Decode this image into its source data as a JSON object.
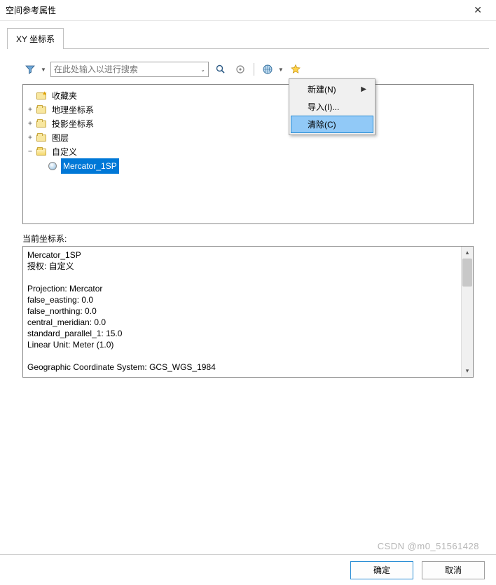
{
  "window": {
    "title": "空间参考属性",
    "close": "✕"
  },
  "tabs": {
    "active": "XY 坐标系"
  },
  "toolbar": {
    "search_placeholder": "在此处输入以进行搜索"
  },
  "dropdown": {
    "items": [
      {
        "label": "新建(N)",
        "has_submenu": true,
        "highlight": false
      },
      {
        "label": "导入(I)...",
        "has_submenu": false,
        "highlight": false
      },
      {
        "label": "清除(C)",
        "has_submenu": false,
        "highlight": true
      }
    ]
  },
  "tree": {
    "nodes": [
      {
        "label": "收藏夹",
        "icon": "fav",
        "toggle": "",
        "indent": 1
      },
      {
        "label": "地理坐标系",
        "icon": "folder-closed",
        "toggle": "+",
        "indent": 1
      },
      {
        "label": "投影坐标系",
        "icon": "folder-closed",
        "toggle": "+",
        "indent": 1
      },
      {
        "label": "图层",
        "icon": "folder-closed",
        "toggle": "+",
        "indent": 1
      },
      {
        "label": "自定义",
        "icon": "folder-open",
        "toggle": "−",
        "indent": 1
      },
      {
        "label": "Mercator_1SP",
        "icon": "crs",
        "toggle": "",
        "indent": 2,
        "selected": true
      }
    ]
  },
  "current": {
    "label": "当前坐标系:",
    "name": "Mercator_1SP",
    "authority_label": "授权: 自定义",
    "projection": "Projection: Mercator",
    "false_easting": "false_easting: 0.0",
    "false_northing": "false_northing: 0.0",
    "central_meridian": "central_meridian: 0.0",
    "standard_parallel": "standard_parallel_1: 15.0",
    "linear_unit": "Linear Unit: Meter (1.0)",
    "gcs": "Geographic Coordinate System: GCS_WGS_1984"
  },
  "buttons": {
    "ok": "确定",
    "cancel": "取消"
  },
  "watermark": "CSDN @m0_51561428"
}
